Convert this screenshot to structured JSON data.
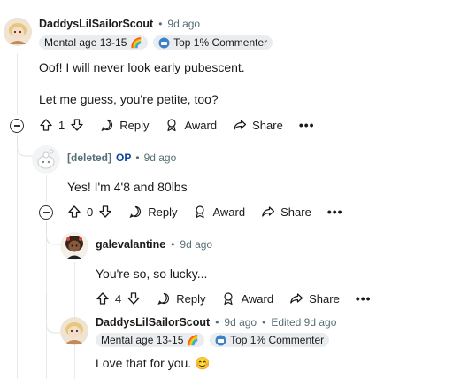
{
  "comments": [
    {
      "author": "DaddysLilSailorScout",
      "time": "9d ago",
      "flair1": "Mental age 13-15",
      "flair2": "Top 1% Commenter",
      "body1": "Oof! I will never look early pubescent.",
      "body2": "Let me guess, you're petite, too?",
      "votes": "1",
      "reply": "Reply",
      "award": "Award",
      "share": "Share"
    },
    {
      "author": "[deleted]",
      "op": "OP",
      "time": "9d ago",
      "body": "Yes! I'm 4'8 and 80lbs",
      "votes": "0",
      "reply": "Reply",
      "award": "Award",
      "share": "Share"
    },
    {
      "author": "galevalantine",
      "time": "9d ago",
      "body": "You're so, so lucky...",
      "votes": "4",
      "reply": "Reply",
      "award": "Award",
      "share": "Share"
    },
    {
      "author": "DaddysLilSailorScout",
      "time": "9d ago",
      "edited": "Edited 9d ago",
      "flair1": "Mental age 13-15",
      "flair2": "Top 1% Commenter",
      "body": "Love that for you. 😊"
    }
  ],
  "separator": "•",
  "more": "•••"
}
